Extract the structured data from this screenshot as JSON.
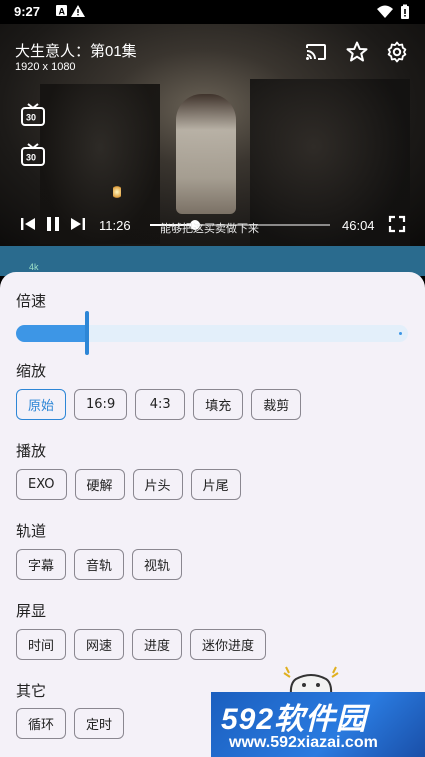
{
  "status_bar": {
    "time": "9:27",
    "icons": [
      "a-box-icon",
      "warning-icon",
      "wifi-icon",
      "battery-icon"
    ]
  },
  "player": {
    "title": "大生意人：第01集",
    "resolution": "1920 x 1080",
    "top_icons": [
      "cast-icon",
      "star-icon",
      "gear-icon"
    ],
    "side_icons": [
      "tv-30s-icon",
      "tv-30s-forward-icon"
    ],
    "current_time": "11:26",
    "total_time": "46:04",
    "progress": 0.248,
    "subtitle": "能够把这买卖做下来"
  },
  "behind_strip": {
    "badge": "4k"
  },
  "sheet": {
    "speed": {
      "title": "倍速",
      "level": 0.18
    },
    "zoom": {
      "title": "缩放",
      "options": [
        "原始",
        "16:9",
        "4:3",
        "填充",
        "裁剪"
      ],
      "selected": "原始"
    },
    "playback": {
      "title": "播放",
      "options": [
        "EXO",
        "硬解",
        "片头",
        "片尾"
      ]
    },
    "tracks": {
      "title": "轨道",
      "options": [
        "字幕",
        "音轨",
        "视轨"
      ]
    },
    "screen": {
      "title": "屏显",
      "options": [
        "时间",
        "网速",
        "进度",
        "迷你进度"
      ]
    },
    "other": {
      "title": "其它",
      "options": [
        "循环",
        "定时"
      ]
    }
  },
  "watermark": {
    "logo": "592软件园",
    "url": "www.592xiazai.com"
  },
  "colors": {
    "accent": "#2d86d6",
    "sheet_bg": "#f4f1f8",
    "chip_border": "#8a8790"
  }
}
